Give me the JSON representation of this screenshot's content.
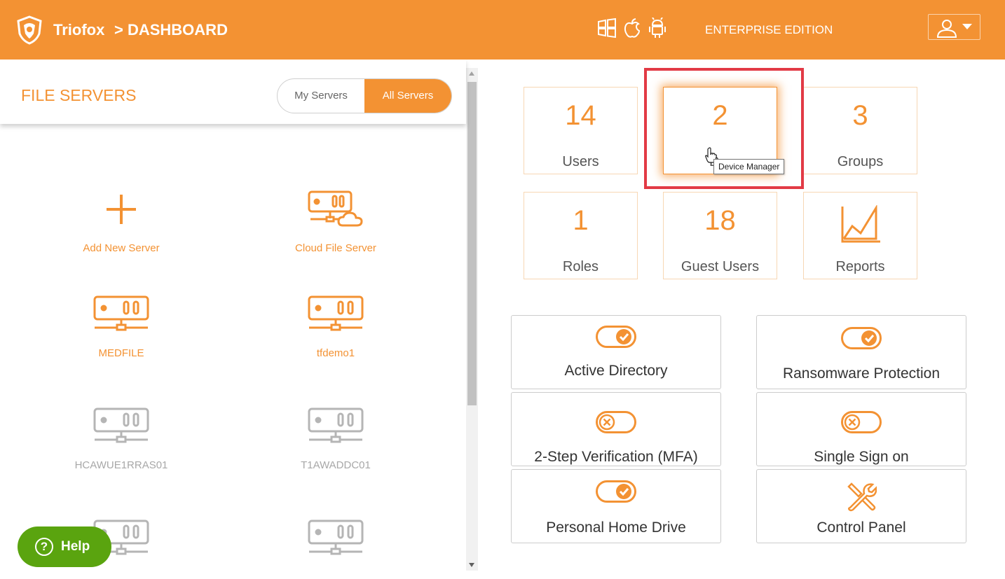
{
  "header": {
    "app_name": "Triofox",
    "breadcrumb": "> DASHBOARD",
    "edition": "ENTERPRISE EDITION",
    "platform_icons": [
      "windows-icon",
      "apple-icon",
      "android-icon"
    ],
    "brand_color": "#f39233"
  },
  "left_panel": {
    "title": "FILE SERVERS",
    "filter": {
      "options": [
        "My Servers",
        "All Servers"
      ],
      "selected": "All Servers"
    },
    "tiles": [
      {
        "label": "Add New Server",
        "icon": "plus-icon",
        "enabled": true
      },
      {
        "label": "Cloud File Server",
        "icon": "cloud-server-icon",
        "enabled": true
      },
      {
        "label": "MEDFILE",
        "icon": "server-icon",
        "enabled": true
      },
      {
        "label": "tfdemo1",
        "icon": "server-icon",
        "enabled": true
      },
      {
        "label": "HCAWUE1RRAS01",
        "icon": "server-icon",
        "enabled": false
      },
      {
        "label": "T1AWADDC01",
        "icon": "server-icon",
        "enabled": false
      }
    ],
    "help": {
      "label": "Help"
    }
  },
  "stats": [
    {
      "count": "14",
      "label": "Users"
    },
    {
      "count": "2",
      "label": "D..."
    },
    {
      "count": "3",
      "label": "Groups"
    },
    {
      "count": "1",
      "label": "Roles"
    },
    {
      "count": "18",
      "label": "Guest Users"
    },
    {
      "count": "",
      "label": "Reports"
    }
  ],
  "tooltip": "Device Manager",
  "features": [
    {
      "label": "Active Directory",
      "state": "on"
    },
    {
      "label": "Ransomware Protection",
      "state": "on"
    },
    {
      "label": "2-Step Verification (MFA)",
      "state": "off"
    },
    {
      "label": "Single Sign on",
      "state": "off"
    },
    {
      "label": "Personal Home Drive",
      "state": "on"
    },
    {
      "label": "Control Panel",
      "state": "tool"
    }
  ]
}
